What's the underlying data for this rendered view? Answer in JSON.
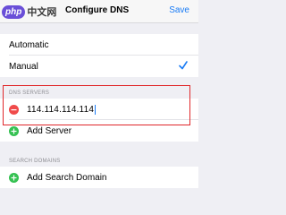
{
  "navbar": {
    "watermark_logo": "php",
    "watermark_text": "中文网",
    "title": "Configure DNS",
    "save_label": "Save"
  },
  "mode": {
    "options": [
      {
        "label": "Automatic",
        "selected": false
      },
      {
        "label": "Manual",
        "selected": true
      }
    ]
  },
  "dns_servers": {
    "header": "DNS SERVERS",
    "entries": [
      "114.114.114.114"
    ],
    "add_label": "Add Server"
  },
  "search_domains": {
    "header": "SEARCH DOMAINS",
    "add_label": "Add Search Domain"
  },
  "colors": {
    "accent": "#1a7cf5",
    "delete": "#f04a4a",
    "add": "#35c152",
    "highlight": "#e0282b"
  }
}
